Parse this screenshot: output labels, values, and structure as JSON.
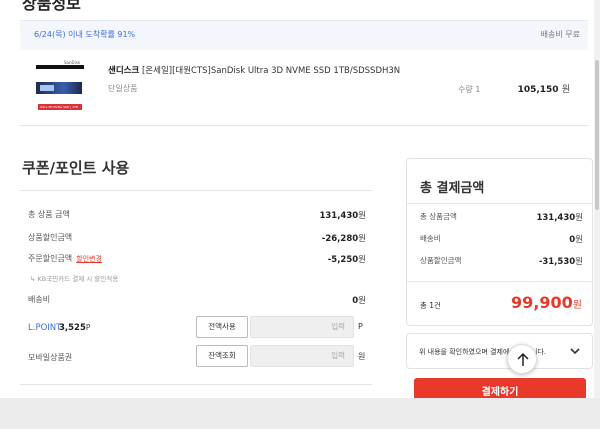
{
  "section_title": "상품정보",
  "shipping": {
    "date_text": "6/24(목) 이내 도착확률 91%",
    "fee_text": "배송비 무료"
  },
  "product": {
    "brand": "샌디스크",
    "name": "[온세일][대원CTS]SanDisk Ultra 3D NVME SSD 1TB/SDSSDH3N",
    "option": "단일상품",
    "quantity": "수량 1",
    "price": "105,150",
    "price_unit": "원",
    "thumbnail": {
      "brand_text": "SanDisk",
      "label_text": "Ultra 3D NVMe SSD | 1TB"
    }
  },
  "coupon": {
    "title": "쿠폰/포인트 사용",
    "rows": [
      {
        "label": "총 상품 금액",
        "value": "131,430",
        "unit": "원"
      },
      {
        "label": "상품할인금액",
        "value": "-26,280",
        "unit": "원"
      },
      {
        "label": "주문할인금액",
        "link": "할인변경",
        "value": "-5,250",
        "unit": "원"
      },
      {
        "label": "배송비",
        "value": "0",
        "unit": "원"
      }
    ],
    "note": "KB국민카드 결제 시 할인적용",
    "lpoint": {
      "label": "L.POINT",
      "value": "3,525",
      "unit": "P",
      "button": "전액사용",
      "placeholder": "입력",
      "suffix": "P"
    },
    "mobile_gift": {
      "label": "모바일상품권",
      "button": "잔액조회",
      "placeholder": "입력",
      "suffix": "원"
    }
  },
  "payment": {
    "title": "총 결제금액",
    "rows": [
      {
        "label": "총 상품금액",
        "value": "131,430",
        "unit": "원"
      },
      {
        "label": "배송비",
        "value": "0",
        "unit": "원"
      },
      {
        "label": "상품할인금액",
        "value": "-31,530",
        "unit": "원"
      }
    ],
    "total_label": "총 1건",
    "total_amount": "99,900",
    "total_unit": "원",
    "agreement_text": "위 내용을 확인하였으며 결제에 동의합니다.",
    "pay_button": "결제하기"
  },
  "colors": {
    "accent_red": "#e8392b",
    "accent_blue": "#3f6fd8"
  },
  "icons": {
    "chevron": "chevron-down-icon",
    "scroll_top": "arrow-up-icon"
  }
}
